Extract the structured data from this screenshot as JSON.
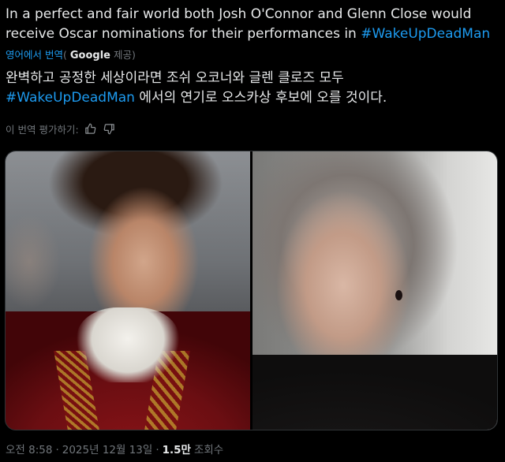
{
  "tweet": {
    "text_main": "In a perfect and fair world both Josh O'Connor and Glenn Close would receive Oscar nominations for their performances in ",
    "hashtag": "#WakeUpDeadMan"
  },
  "translation": {
    "source_label": "영어에서 번역",
    "paren_open": "(",
    "provider": "Google",
    "provider_suffix": "제공)",
    "text_hashtag_line1": "완벽하고 공정한 세상이라면 조쉬 오코너와 글렌 클로즈 모두",
    "hashtag": "#WakeUpDeadMan",
    "text_after_hashtag": " 에서의 연기로 오스카상 후보에 오를 것이다.",
    "rate_label": "이 번역 평가하기:"
  },
  "meta": {
    "time": "오전 8:58",
    "separator1": "·",
    "date": "2025년 12월 13일",
    "separator2": "·",
    "views_count": "1.5만",
    "views_label": "조회수"
  },
  "colors": {
    "background": "#000000",
    "text": "#e7e9ea",
    "secondary": "#71767b",
    "link": "#1d9bf0"
  },
  "icons": {
    "thumbs_up": "thumbs-up-icon",
    "thumbs_down": "thumbs-down-icon"
  }
}
